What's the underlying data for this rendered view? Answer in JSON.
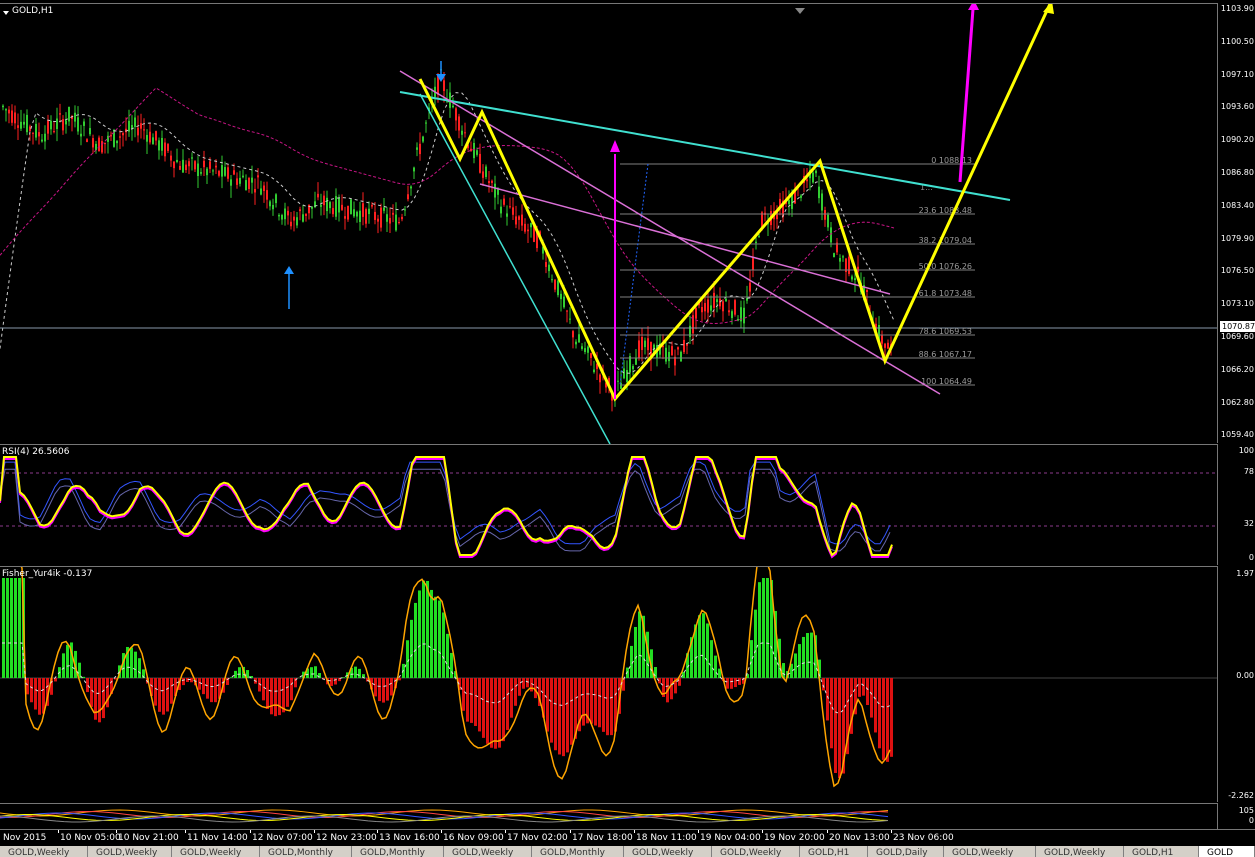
{
  "main": {
    "title": "GOLD,H1",
    "price_levels": [
      "1103.90",
      "1100.50",
      "1097.10",
      "1093.60",
      "1090.20",
      "1086.80",
      "1083.40",
      "1079.90",
      "1076.50",
      "1073.10",
      "1069.60",
      "1066.20",
      "1062.80",
      "1059.40"
    ],
    "current_price": "1070.87",
    "fib_labels": [
      "0 1088.13",
      "23.6 1083.48",
      "38.2 1079.04",
      "50.0 1076.26",
      "61.8 1073.48",
      "78.6 1069.53",
      "88.6 1067.17",
      "100 1064.49"
    ],
    "fib_partial_label": "1..."
  },
  "rsi": {
    "title": "RSI(4) 26.5606",
    "levels": [
      "100",
      "78",
      "32",
      "0"
    ]
  },
  "fisher": {
    "title": "Fisher_Yur4ik -0.137",
    "levels": [
      "1.97",
      "0.00",
      "-2.262"
    ]
  },
  "bottom": {
    "levels": [
      "105",
      "0"
    ]
  },
  "time_axis": [
    "Nov 2015",
    "10 Nov 05:00",
    "10 Nov 21:00",
    "11 Nov 14:00",
    "12 Nov 07:00",
    "12 Nov 23:00",
    "13 Nov 16:00",
    "16 Nov 09:00",
    "17 Nov 02:00",
    "17 Nov 18:00",
    "18 Nov 11:00",
    "19 Nov 04:00",
    "19 Nov 20:00",
    "20 Nov 13:00",
    "23 Nov 06:00"
  ],
  "tabs": [
    "GOLD,Weekly",
    "GOLD,Weekly",
    "GOLD,Weekly",
    "GOLD,Monthly",
    "GOLD,Monthly",
    "GOLD,Weekly",
    "GOLD,Monthly",
    "GOLD,Weekly",
    "GOLD,Weekly",
    "GOLD,H1",
    "GOLD,Daily",
    "GOLD,Weekly",
    "GOLD,Weekly",
    "GOLD,H1",
    "GOLD"
  ],
  "colors": {
    "bull_candle": "#32cd32",
    "bear_candle": "#ff2020",
    "pattern": "#ffff00",
    "target_arrow": "#ff00ff",
    "channel_cyan": "#40e0d0",
    "channel_violet": "#da70d6",
    "fib": "#808080",
    "rsi_main": "#ffff00",
    "fisher_pos": "#22dd22",
    "fisher_neg": "#dd1111",
    "fisher_line": "#ffa500"
  }
}
